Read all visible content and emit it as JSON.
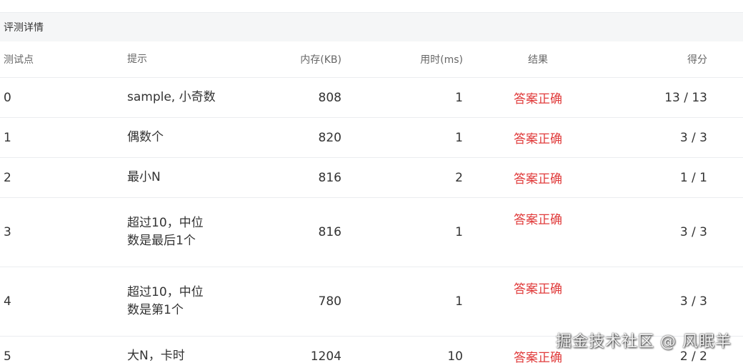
{
  "section": {
    "title": "评测详情"
  },
  "columns": {
    "id": "测试点",
    "hint": "提示",
    "memory": "内存(KB)",
    "time": "用时(ms)",
    "result": "结果",
    "score": "得分"
  },
  "rows": [
    {
      "id": "0",
      "hint_lines": [
        "sample, 小奇数"
      ],
      "memory": "808",
      "time": "1",
      "result": "答案正确",
      "score": "13 / 13"
    },
    {
      "id": "1",
      "hint_lines": [
        "偶数个"
      ],
      "memory": "820",
      "time": "1",
      "result": "答案正确",
      "score": "3 / 3"
    },
    {
      "id": "2",
      "hint_lines": [
        "最小N"
      ],
      "memory": "816",
      "time": "2",
      "result": "答案正确",
      "score": "1 / 1"
    },
    {
      "id": "3",
      "hint_lines": [
        "超过10，中位",
        "数是最后1个"
      ],
      "memory": "816",
      "time": "1",
      "result": "答案正确",
      "score": "3 / 3"
    },
    {
      "id": "4",
      "hint_lines": [
        "超过10，中位",
        "数是第1个"
      ],
      "memory": "780",
      "time": "1",
      "result": "答案正确",
      "score": "3 / 3"
    },
    {
      "id": "5",
      "hint_lines": [
        "大N，卡时"
      ],
      "memory": "1204",
      "time": "10",
      "result": "答案正确",
      "score": "2 / 2"
    }
  ],
  "watermark": "掘金技术社区 @ 风眠羊",
  "colors": {
    "accepted": "#e03a3a",
    "header_bg": "#f5f6f7",
    "border": "#ebedf0"
  }
}
